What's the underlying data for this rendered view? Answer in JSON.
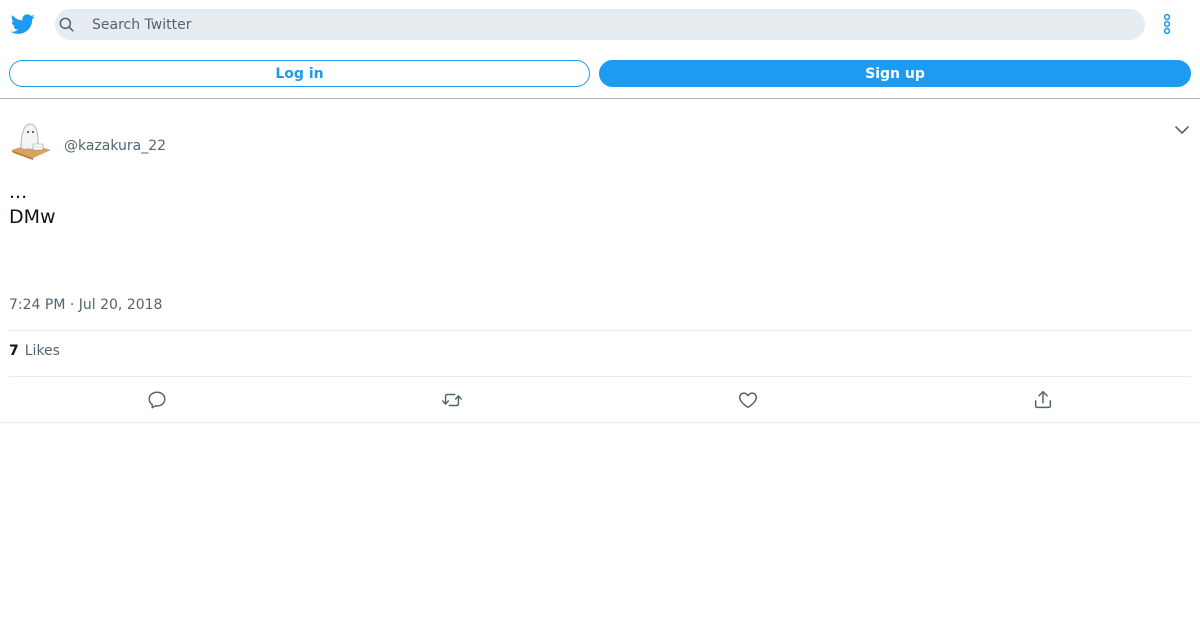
{
  "header": {
    "logo_icon": "twitter-bird-icon",
    "search_placeholder": "Search Twitter",
    "more_icon": "vertical-dots-icon"
  },
  "auth": {
    "login_label": "Log in",
    "signup_label": "Sign up"
  },
  "tweet": {
    "handle": "@kazakura_22",
    "text": "...\nDMw",
    "timestamp": "7:24 PM · Jul 20, 2018",
    "likes_count": "7",
    "likes_label": "Likes"
  },
  "actions": [
    "reply-icon",
    "retweet-icon",
    "like-icon",
    "share-icon"
  ],
  "colors": {
    "accent": "#1d9bf0",
    "secondary_text": "#536471",
    "search_bg": "#e7ecf0"
  }
}
